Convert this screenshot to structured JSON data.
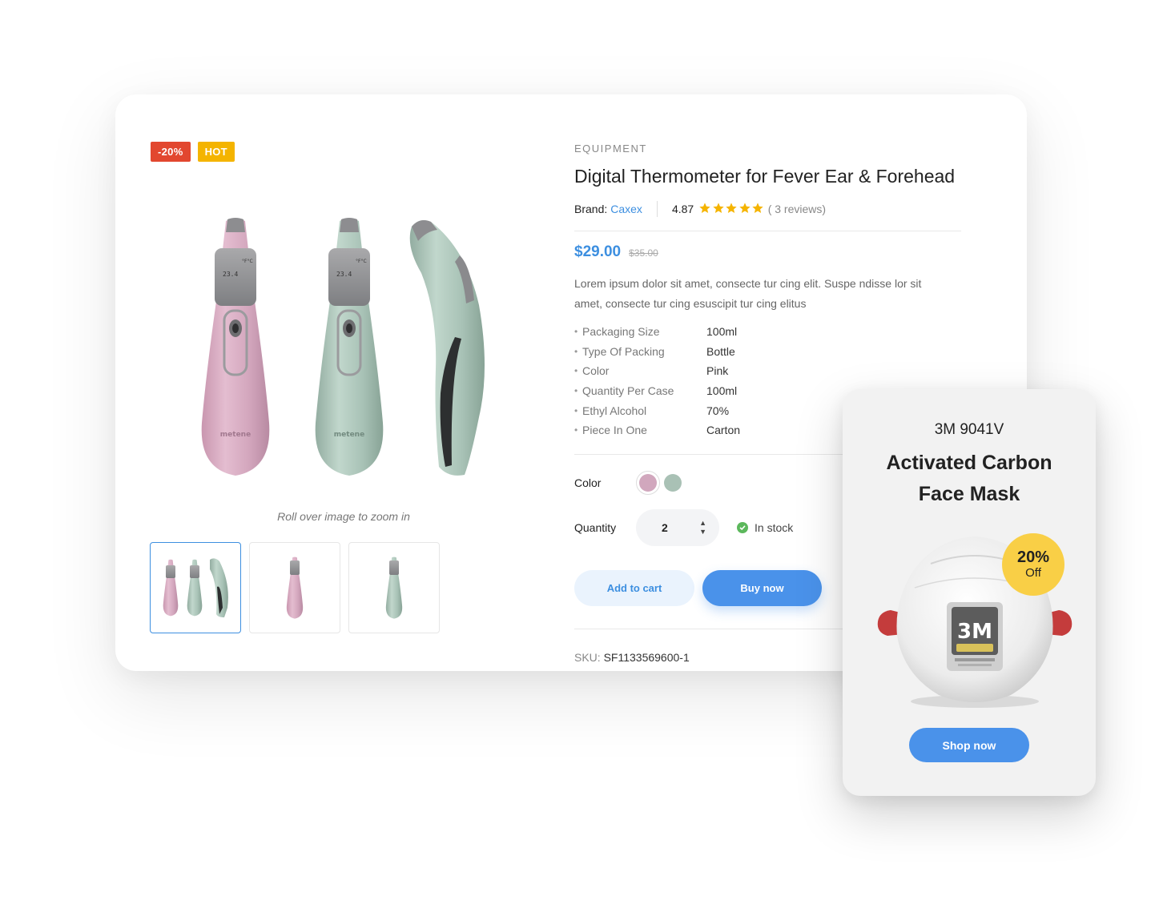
{
  "product": {
    "badges": {
      "discount": "-20%",
      "hot": "HOT"
    },
    "zoom_hint": "Roll over image to zoom in",
    "category": "EQUIPMENT",
    "title": "Digital Thermometer for Fever Ear & Forehead",
    "brand_label": "Brand:",
    "brand": "Caxex",
    "rating": "4.87",
    "rating_stars": 5,
    "reviews": "( 3 reviews)",
    "price": "$29.00",
    "old_price": "$35.00",
    "description": "Lorem ipsum dolor sit amet, consecte tur cing elit. Suspe ndisse lor sit amet, consecte tur cing esuscipit tur cing elitus",
    "specs": [
      {
        "key": "Packaging Size",
        "value": "100ml"
      },
      {
        "key": "Type Of Packing",
        "value": "Bottle"
      },
      {
        "key": "Color",
        "value": "Pink"
      },
      {
        "key": "Quantity Per Case",
        "value": "100ml"
      },
      {
        "key": "Ethyl Alcohol",
        "value": "70%"
      },
      {
        "key": "Piece In One",
        "value": "Carton"
      }
    ],
    "color_label": "Color",
    "colors": [
      "#d1a7bd",
      "#a9c1b5"
    ],
    "quantity_label": "Quantity",
    "quantity": "2",
    "stock": "In stock",
    "add_to_cart": "Add to cart",
    "buy_now": "Buy now",
    "sku_label": "SKU:",
    "sku": "SF1133569600-1",
    "device_brand": "metene"
  },
  "promo": {
    "model": "3M 9041V",
    "name_line1": "Activated Carbon",
    "name_line2": "Face Mask",
    "discount_pct": "20%",
    "discount_off": "Off",
    "shop_now": "Shop now",
    "mask_logo": "3M"
  },
  "colors": {
    "accent": "#3d8fe0",
    "sale_badge": "#e2472f",
    "hot_badge": "#f4b400",
    "star": "#f5b400",
    "in_stock": "#5cb85c",
    "promo_badge": "#f9cf46"
  }
}
